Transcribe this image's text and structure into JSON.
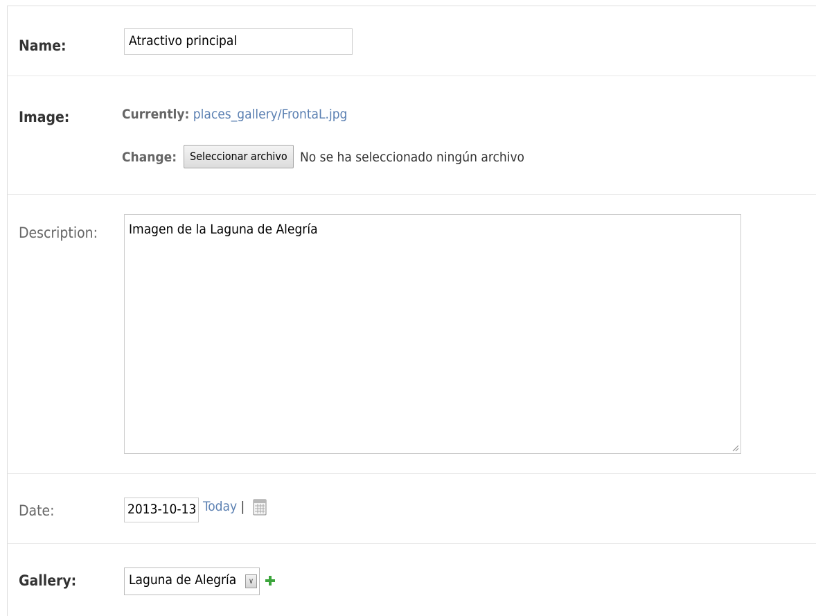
{
  "form": {
    "name": {
      "label": "Name:",
      "value": "Atractivo principal"
    },
    "image": {
      "label": "Image:",
      "currently_label": "Currently:",
      "currently_link": "places_gallery/FrontaL.jpg",
      "change_label": "Change:",
      "file_button": "Seleccionar archivo",
      "no_file_text": "No se ha seleccionado ningún archivo"
    },
    "description": {
      "label": "Description:",
      "value": "Imagen de la Laguna de Alegría"
    },
    "date": {
      "label": "Date:",
      "value": "2013-10-13",
      "today_link": "Today",
      "separator": "|",
      "calendar_icon": "calendar-icon"
    },
    "gallery": {
      "label": "Gallery:",
      "selected": "Laguna de Alegría",
      "dropdown_icon": "chevron-down-icon",
      "add_icon": "plus-icon"
    }
  },
  "colors": {
    "link": "#5b80b2",
    "add_icon": "#3ca53c",
    "border": "#cccccc"
  }
}
